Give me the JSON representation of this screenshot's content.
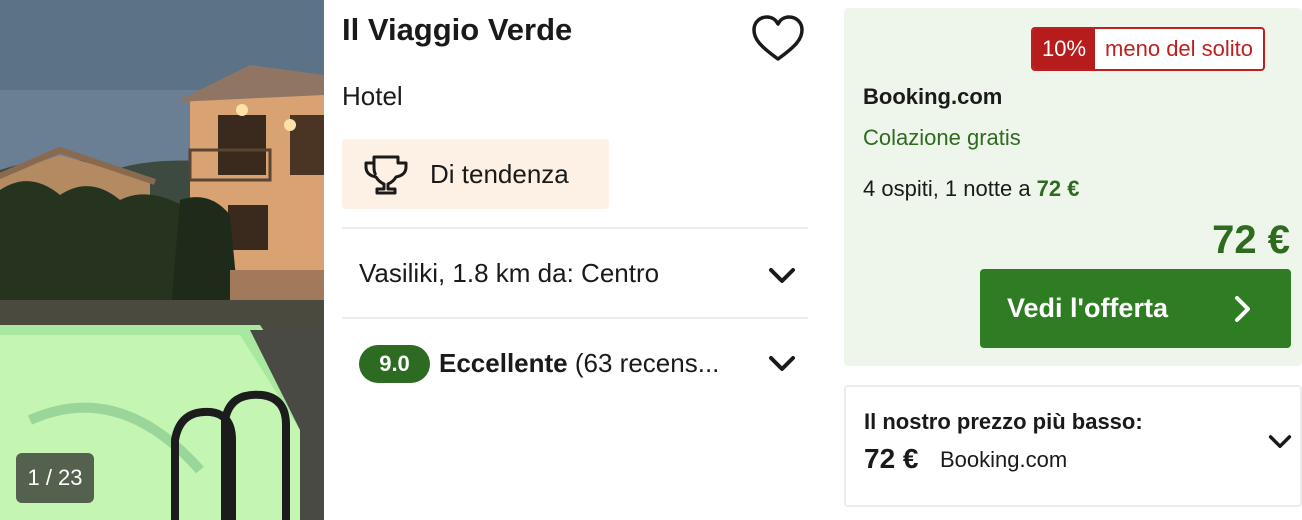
{
  "photo": {
    "counter": "1 / 23"
  },
  "hotel": {
    "name": "Il Viaggio Verde",
    "type": "Hotel",
    "trend_label": "Di tendenza",
    "location": "Vasiliki, 1.8 km da: Centro",
    "rating_score": "9.0",
    "rating_label": "Eccellente",
    "rating_reviews": "(63 recens..."
  },
  "offer": {
    "discount_pct": "10%",
    "discount_text": "meno del solito",
    "provider": "Booking.com",
    "perk": "Colazione gratis",
    "guests_text": "4 ospiti, 1 notte a ",
    "guests_price": "72 €",
    "price": "72 €",
    "cta_label": "Vedi l'offerta"
  },
  "lowest": {
    "title": "Il nostro prezzo più basso:",
    "price": "72 €",
    "provider": "Booking.com"
  },
  "colors": {
    "accent_green": "#2e7d22",
    "price_green": "#2e6b1f",
    "badge_red": "#b71c1c",
    "offer_bg": "#eef6ec",
    "trend_bg": "#fcf1e4"
  },
  "icons": [
    "heart-icon",
    "trophy-icon",
    "chevron-down-icon",
    "chevron-right-icon"
  ]
}
